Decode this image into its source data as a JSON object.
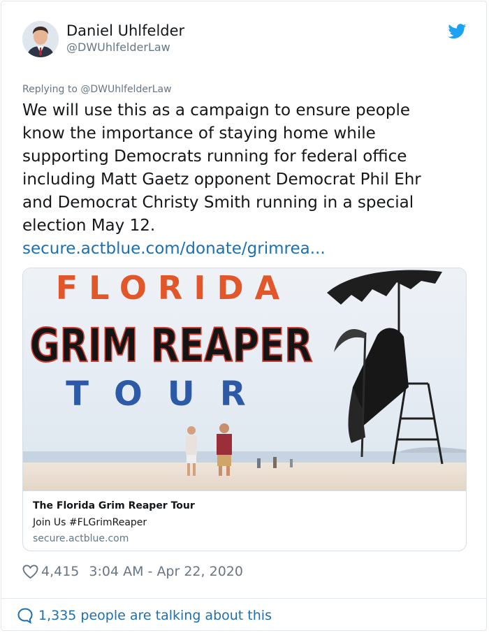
{
  "author": {
    "display_name": "Daniel Uhlfelder",
    "handle": "@DWUhlfelderLaw"
  },
  "brand": {
    "icon": "twitter-bird-icon",
    "color": "#1da1f2"
  },
  "replying_to": "Replying to @DWUhlfelderLaw",
  "tweet": {
    "text": "We will use this as a campaign to ensure people know the importance of staying home while supporting Democrats running for federal office including Matt Gaetz opponent Democrat Phil Ehr and Democrat Christy Smith running in a special election May 12.",
    "link": "secure.actblue.com/donate/grimrea..."
  },
  "media": {
    "headline_top": "FLORIDA",
    "headline_mid": "GRIM REAPER",
    "headline_bottom": "TOUR"
  },
  "card": {
    "title": "The Florida Grim Reaper Tour",
    "description": "Join Us #FLGrimReaper",
    "domain": "secure.actblue.com"
  },
  "stats": {
    "likes": "4,415",
    "timestamp": "3:04 AM - Apr 22, 2020"
  },
  "footer": {
    "talking_text": "1,335 people are talking about this"
  },
  "colors": {
    "link": "#1b6fb3",
    "secondary_text": "#657786",
    "headline_orange": "#e1572a",
    "headline_blue": "#2d5aa6"
  }
}
